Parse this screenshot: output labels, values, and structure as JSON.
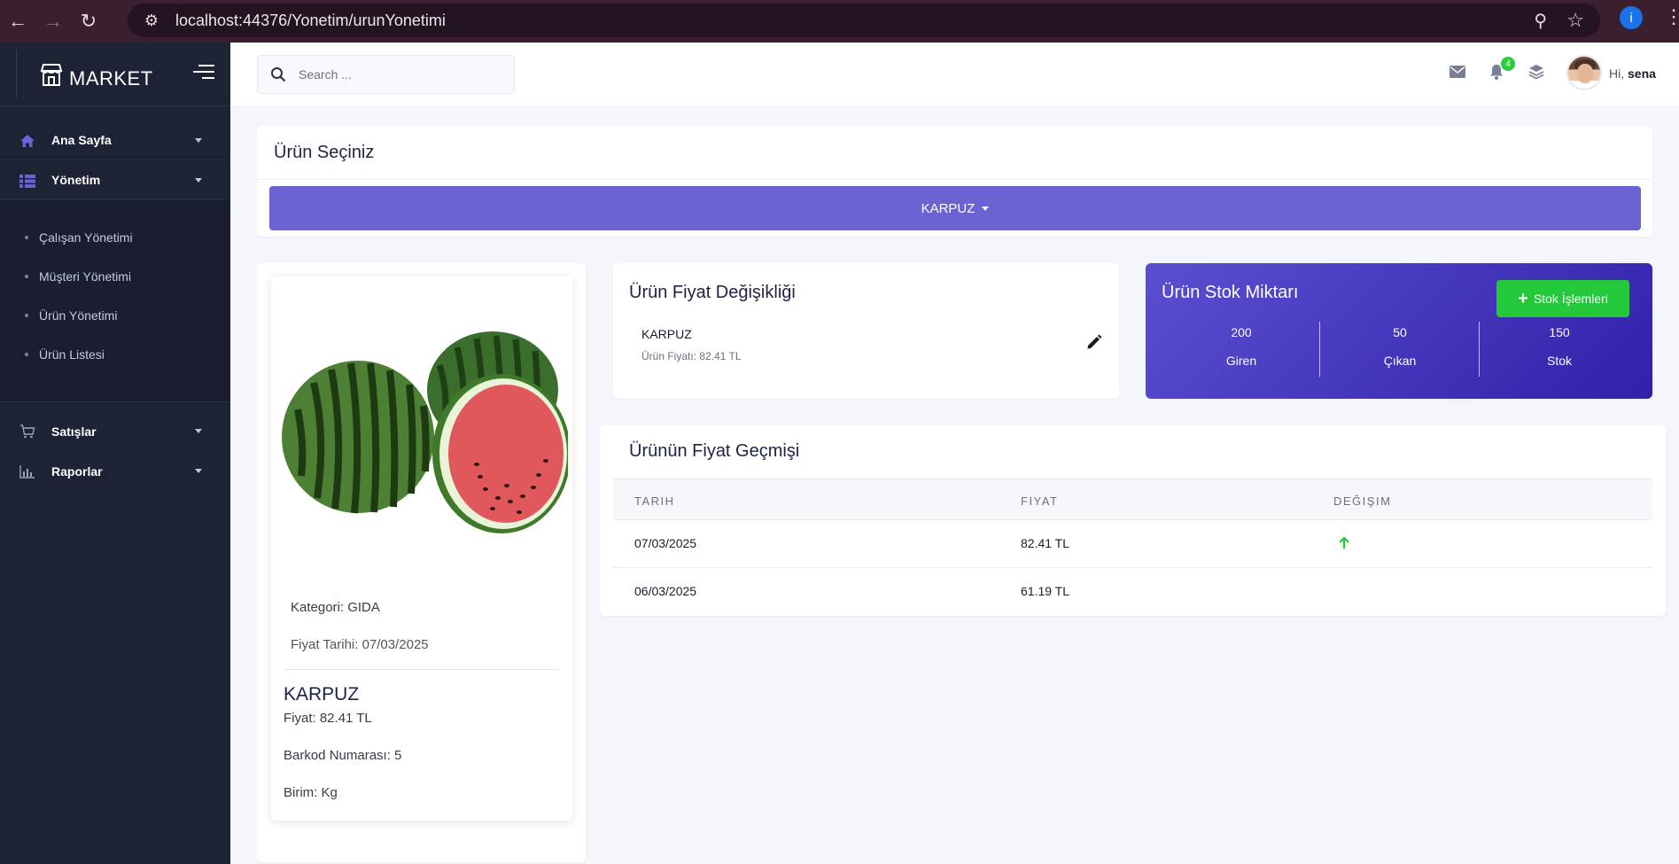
{
  "browser": {
    "url": "localhost:44376/Yonetim/urunYonetimi"
  },
  "sidebar": {
    "brand": "MARKET",
    "items": [
      {
        "label": "Ana Sayfa"
      },
      {
        "label": "Yönetim"
      },
      {
        "label": "Satışlar"
      },
      {
        "label": "Raporlar"
      }
    ],
    "submenu": [
      {
        "label": "Çalışan Yönetimi"
      },
      {
        "label": "Müşteri Yönetimi"
      },
      {
        "label": "Ürün Yönetimi"
      },
      {
        "label": "Ürün Listesi"
      }
    ]
  },
  "topbar": {
    "search_placeholder": "Search ...",
    "notification_count": "4",
    "greeting": "Hi,",
    "username": "sena"
  },
  "select_card": {
    "title": "Ürün Seçiniz",
    "selected": "KARPUZ"
  },
  "product": {
    "category": "Kategori: GIDA",
    "price_date": "Fiyat Tarihi: 07/03/2025",
    "name": "KARPUZ",
    "price": "Fiyat: 82.41 TL",
    "barcode": "Barkod Numarası: 5",
    "unit": "Birim: Kg"
  },
  "price_change": {
    "title": "Ürün Fiyat Değişikliği",
    "product_name": "KARPUZ",
    "product_price": "Ürün Fiyatı: 82.41 TL"
  },
  "stock": {
    "title": "Ürün Stok Miktarı",
    "button_label": "Stok İşlemleri",
    "stats": [
      {
        "value": "200",
        "label": "Giren"
      },
      {
        "value": "50",
        "label": "Çıkan"
      },
      {
        "value": "150",
        "label": "Stok"
      }
    ]
  },
  "history": {
    "title": "Ürünün Fiyat Geçmişi",
    "columns": [
      "TARIH",
      "FIYAT",
      "DEĞIŞIM"
    ],
    "rows": [
      {
        "date": "07/03/2025",
        "price": "82.41 TL",
        "change": "up"
      },
      {
        "date": "06/03/2025",
        "price": "61.19 TL",
        "change": ""
      }
    ]
  },
  "colors": {
    "accent": "#6c63d3",
    "sidebar": "#1d2235",
    "success": "#23c93a"
  }
}
